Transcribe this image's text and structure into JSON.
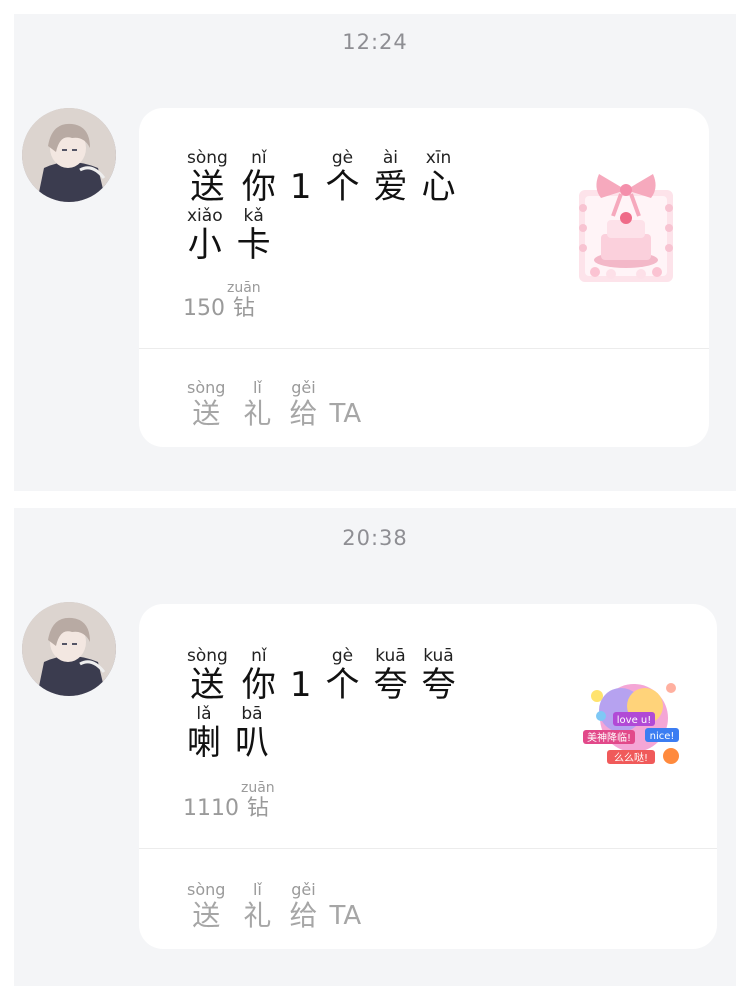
{
  "messages": [
    {
      "time": "12:24",
      "gift_line1": [
        {
          "py": "sòng",
          "hz": "送"
        },
        {
          "py": "nǐ",
          "hz": "你"
        },
        {
          "py": "",
          "hz": "1"
        },
        {
          "py": "gè",
          "hz": "个"
        },
        {
          "py": "ài",
          "hz": "爱"
        },
        {
          "py": "xīn",
          "hz": "心"
        }
      ],
      "gift_line2": [
        {
          "py": "xiǎo",
          "hz": "小"
        },
        {
          "py": "kǎ",
          "hz": "卡"
        }
      ],
      "price_amount": "150",
      "price_unit_py": "zuān",
      "price_unit_hz": "钻",
      "send": [
        {
          "py": "sòng",
          "hz": "送"
        },
        {
          "py": "lǐ",
          "hz": "礼"
        },
        {
          "py": "gěi",
          "hz": "给"
        }
      ],
      "send_target": "TA",
      "gift_icon": "cake-with-bow-icon"
    },
    {
      "time": "20:38",
      "gift_line1": [
        {
          "py": "sòng",
          "hz": "送"
        },
        {
          "py": "nǐ",
          "hz": "你"
        },
        {
          "py": "",
          "hz": "1"
        },
        {
          "py": "gè",
          "hz": "个"
        },
        {
          "py": "kuā",
          "hz": "夸"
        },
        {
          "py": "kuā",
          "hz": "夸"
        }
      ],
      "gift_line2": [
        {
          "py": "lǎ",
          "hz": "喇"
        },
        {
          "py": "bā",
          "hz": "叭"
        }
      ],
      "price_amount": "1110",
      "price_unit_py": "zuān",
      "price_unit_hz": "钻",
      "send": [
        {
          "py": "sòng",
          "hz": "送"
        },
        {
          "py": "lǐ",
          "hz": "礼"
        },
        {
          "py": "gěi",
          "hz": "给"
        }
      ],
      "send_target": "TA",
      "gift_icon": "praise-sticker-icon",
      "sticker_texts": [
        "love u!",
        "美神降临!",
        "nice!",
        "么么哒!"
      ]
    }
  ],
  "colors": {
    "panel_bg": "#f4f5f7",
    "card_bg": "#ffffff",
    "muted_text": "#9a9a9a",
    "main_text": "#111111"
  }
}
